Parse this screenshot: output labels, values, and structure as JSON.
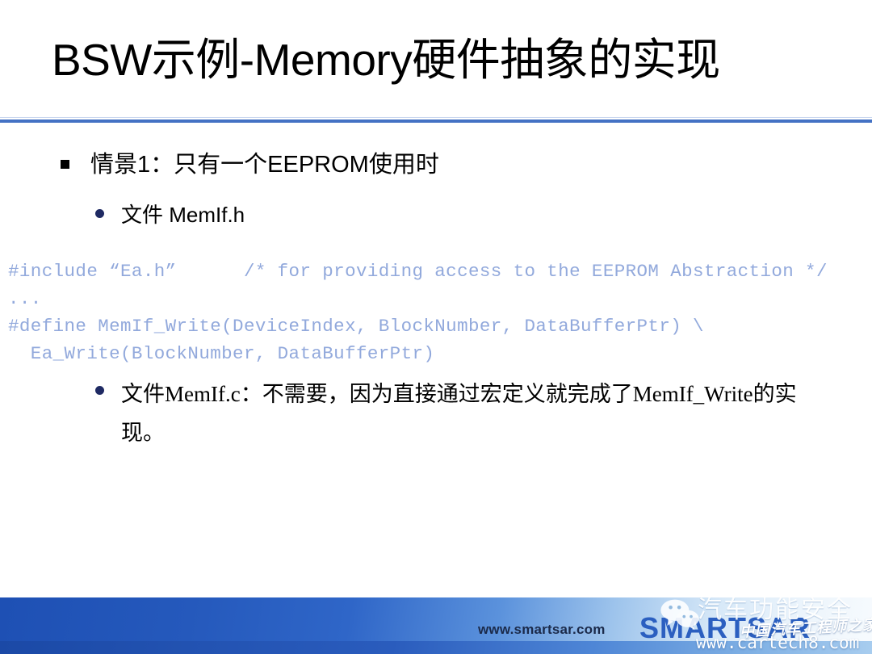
{
  "slide": {
    "title": "BSW示例-Memory硬件抽象的实现",
    "accent_color": "#4472C4",
    "code_color": "#92A9DC"
  },
  "bullets": {
    "level1": "情景1：只有一个EEPROM使用时",
    "sub1": "文件 MemIf.h",
    "sub2": "文件MemIf.c：不需要，因为直接通过宏定义就完成了MemIf_Write的实现。"
  },
  "code": {
    "lines": [
      "#include “Ea.h”      /* for providing access to the EEPROM Abstraction */",
      "...",
      "#define MemIf_Write(DeviceIndex, BlockNumber, DataBufferPtr) \\",
      "  Ea_Write(BlockNumber, DataBufferPtr)"
    ],
    "text": "#include “Ea.h”      /* for providing access to the EEPROM Abstraction */\n...\n#define MemIf_Write(DeviceIndex, BlockNumber, DataBufferPtr) \\\n  Ea_Write(BlockNumber, DataBufferPtr)"
  },
  "footer": {
    "url": "www.smartsar.com",
    "brand": "SMARTSAR"
  },
  "watermark": {
    "icon": "wechat-icon",
    "title": "汽车功能安全",
    "subtitle": "中国汽车工程师之家",
    "url": "www.cartech8.com"
  }
}
